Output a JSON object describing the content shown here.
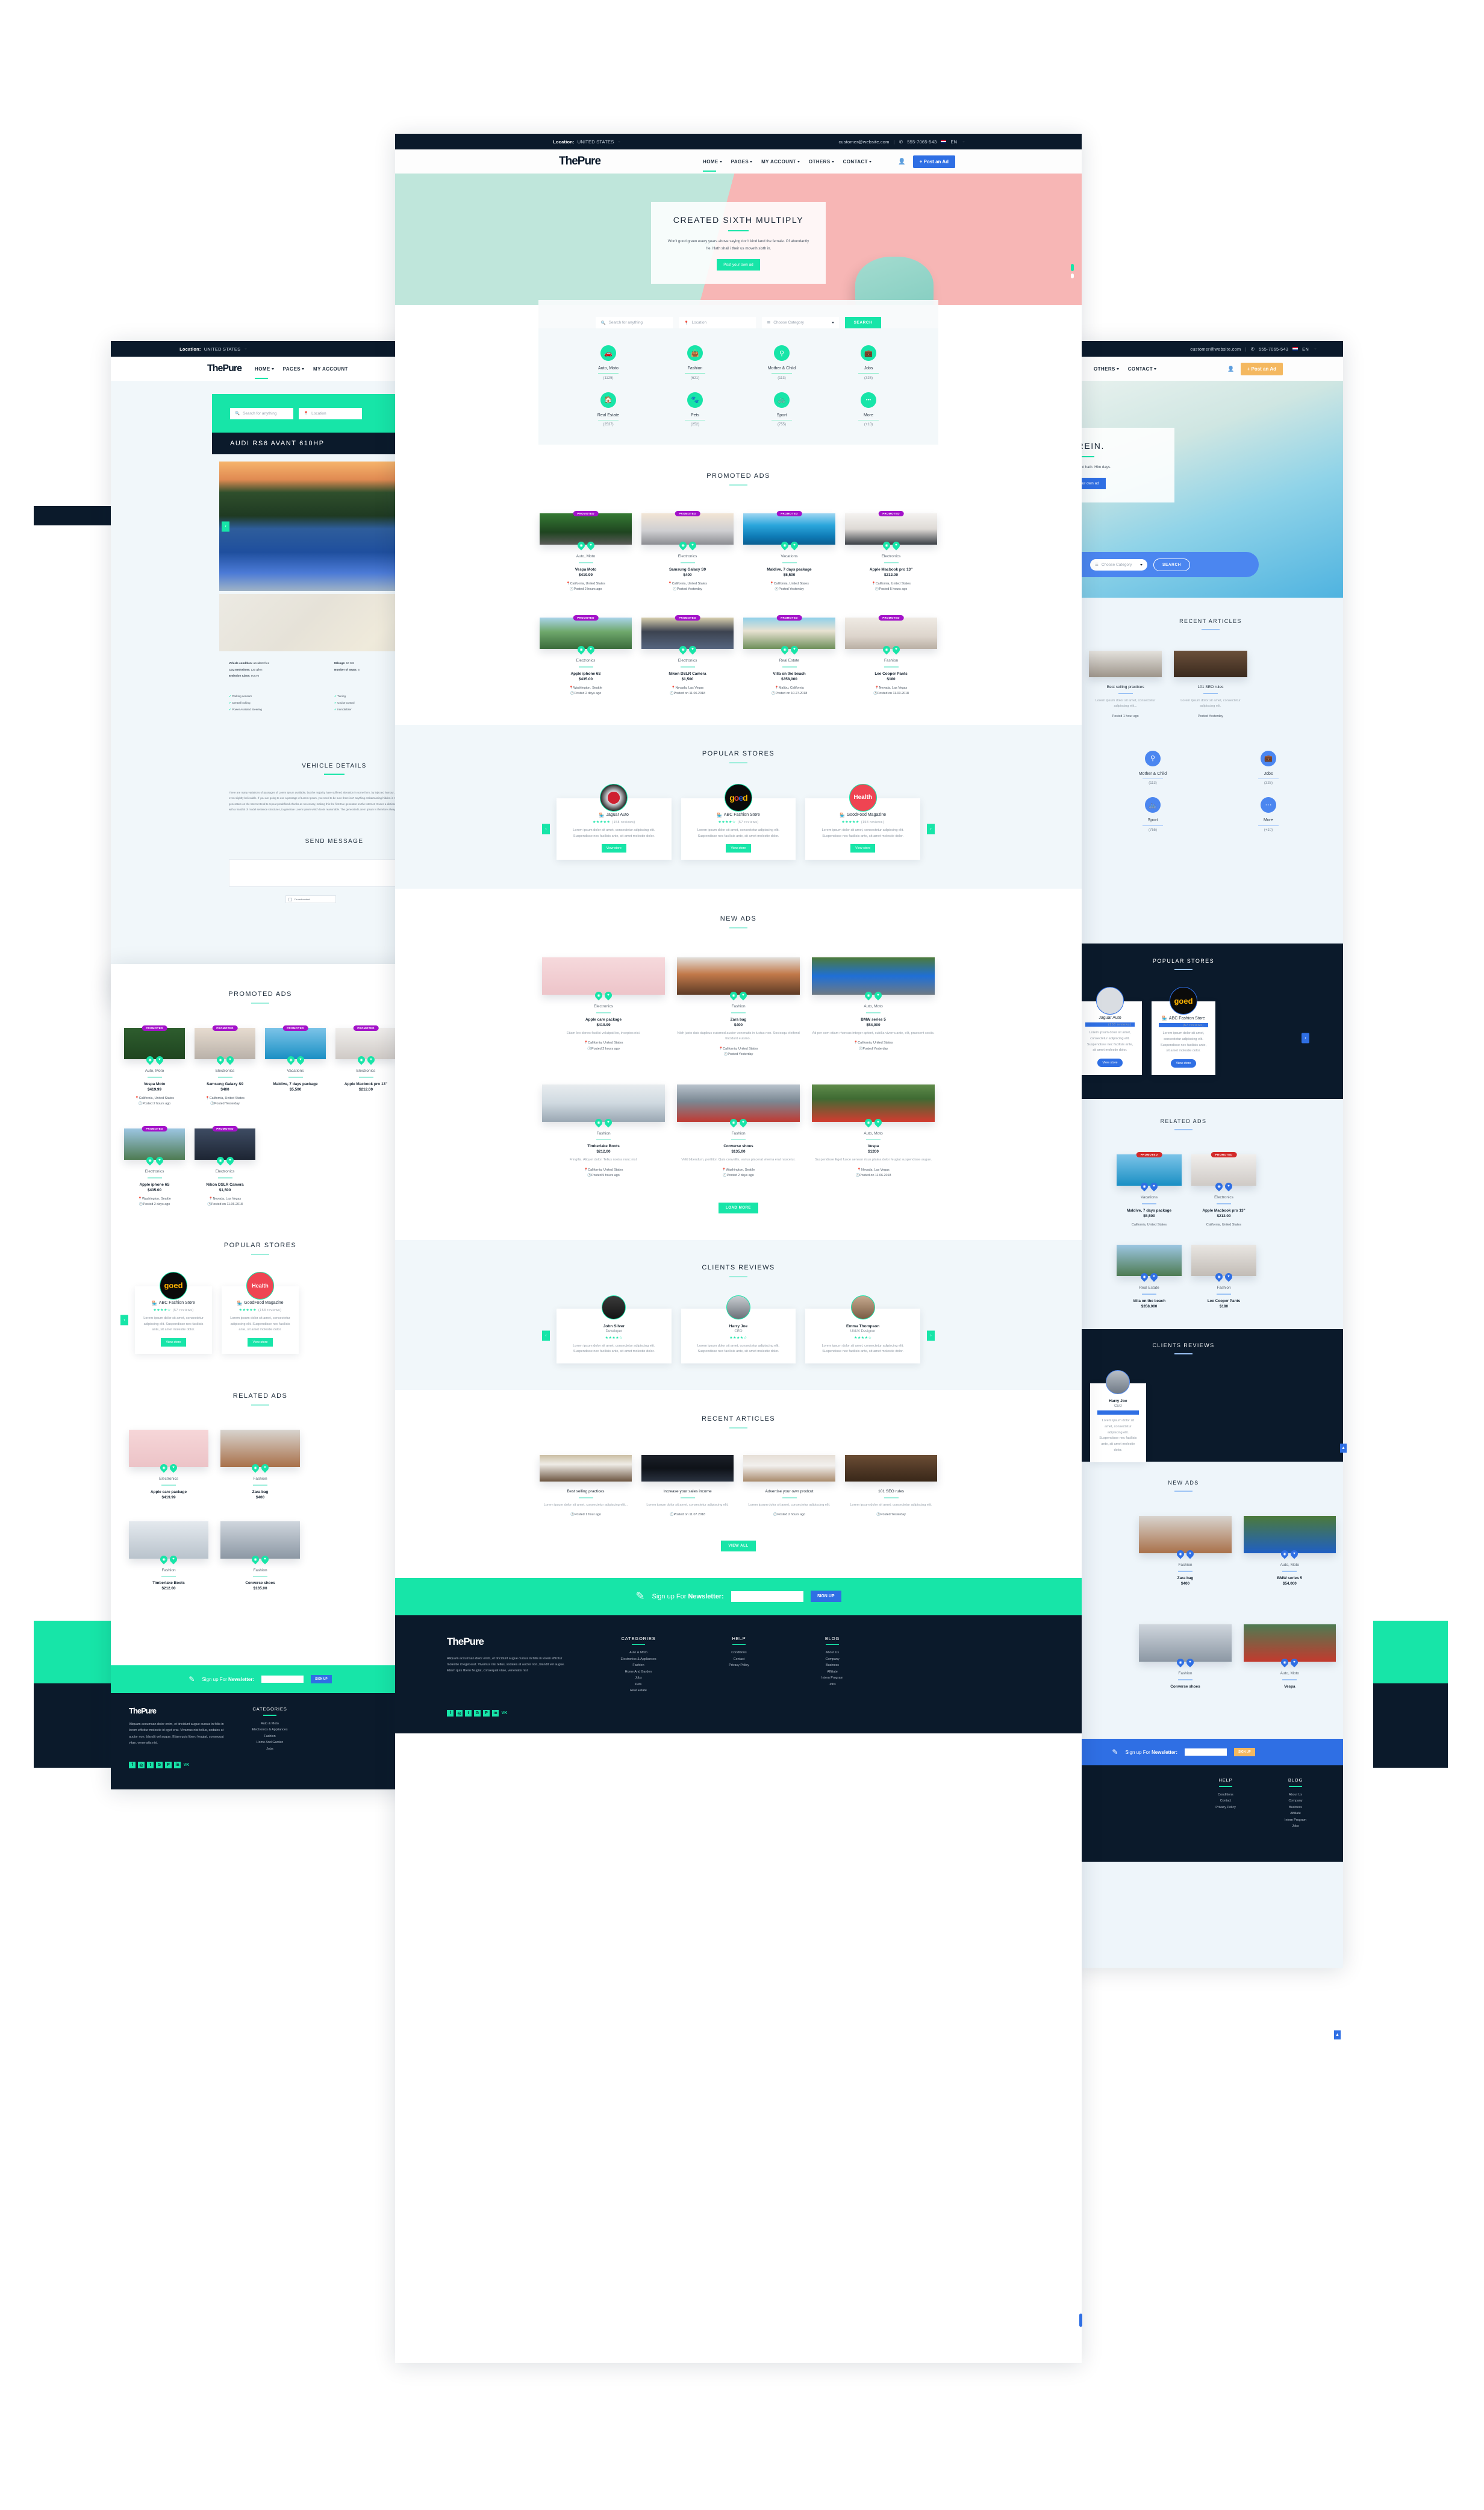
{
  "brand": {
    "name": "ThePure",
    "logo_mark": "ThePure"
  },
  "topbar": {
    "location_label": "Location:",
    "location_value": "UNITED STATES",
    "email": "customer@website.com",
    "phone": "555-7065-543",
    "lang": "EN"
  },
  "nav": {
    "items": [
      {
        "label": "HOME",
        "has_caret": true,
        "active": true
      },
      {
        "label": "PAGES",
        "has_caret": true,
        "active": false
      },
      {
        "label": "MY ACCOUNT",
        "has_caret": true,
        "active": false
      },
      {
        "label": "OTHERS",
        "has_caret": true,
        "active": false
      },
      {
        "label": "CONTACT",
        "has_caret": true,
        "active": false
      }
    ],
    "post_ad": "+ Post an Ad"
  },
  "hero": {
    "title": "CREATED SIXTH MULTIPLY",
    "body": "Won't good green every years above saying don't kind land the female. Of abundantly He. Hath shall i their us moveth sixth in.",
    "cta": "Post your own ad"
  },
  "hero_alt": {
    "title": "HEREIN.",
    "body": "air be firmament hath. Him days.",
    "cta": "Post your own ad"
  },
  "search": {
    "query_placeholder": "Search for anything",
    "location_placeholder": "Location",
    "category_placeholder": "Choose Category",
    "button": "SEARCH"
  },
  "categories": [
    {
      "name": "Auto, Moto",
      "count": "(1125)",
      "icon": "car-icon"
    },
    {
      "name": "Fashion",
      "count": "(621)",
      "icon": "bag-icon"
    },
    {
      "name": "Mother & Child",
      "count": "(113)",
      "icon": "child-icon"
    },
    {
      "name": "Jobs",
      "count": "(325)",
      "icon": "briefcase-icon"
    },
    {
      "name": "Real Estate",
      "count": "(2537)",
      "icon": "home-icon"
    },
    {
      "name": "Pets",
      "count": "(252)",
      "icon": "paw-icon"
    },
    {
      "name": "Sport",
      "count": "(755)",
      "icon": "bicycle-icon"
    },
    {
      "name": "More",
      "count": "(+10)",
      "icon": "ellipsis-icon"
    }
  ],
  "sections": {
    "promoted_ads": "PROMOTED ADS",
    "popular_stores": "POPULAR STORES",
    "new_ads": "NEW ADS",
    "clients_reviews": "CLIENTS REVIEWS",
    "recent_articles": "RECENT ARTICLES",
    "related_ads": "RELATED ADS",
    "vehicle_details": "VEHICLE DETAILS",
    "send_message": "SEND MESSAGE"
  },
  "promoted_badge": "PROMOTED",
  "promoted_ads": [
    {
      "category": "Auto, Moto",
      "title": "Vespa Moto",
      "price": "$419.99",
      "location": "California, United States",
      "posted": "Posted 2 hours ago",
      "photo": "scooter"
    },
    {
      "category": "Electronics",
      "title": "Samsung Galaxy S9",
      "price": "$400",
      "location": "California, United States",
      "posted": "Posted Yesterday",
      "photo": "phone"
    },
    {
      "category": "Vacations",
      "title": "Maldive, 7 days package",
      "price": "$5,500",
      "location": "California, United States",
      "posted": "Posted Yesterday",
      "photo": "island"
    },
    {
      "category": "Electronics",
      "title": "Apple Macbook pro 13\"",
      "price": "$212.00",
      "location": "California, United States",
      "posted": "Posted 5 hours ago",
      "photo": "laptop"
    },
    {
      "category": "Electronics",
      "title": "Apple iphone 6S",
      "price": "$435.00",
      "location": "Washington, Seattle",
      "posted": "Posted 2 days ago",
      "photo": "phonehand"
    },
    {
      "category": "Electronics",
      "title": "Nikon DSLR Camera",
      "price": "$1,500",
      "location": "Nevada, Las Vegas",
      "posted": "Posted on 11.06.2018",
      "photo": "camera"
    },
    {
      "category": "Real Estate",
      "title": "Villa on the beach",
      "price": "$358,000",
      "location": "Malibu, California",
      "posted": "Posted on 10.27.2018",
      "photo": "villa"
    },
    {
      "category": "Fashion",
      "title": "Lee Cooper Pants",
      "price": "$180",
      "location": "Nevada, Las Vegas",
      "posted": "Posted on 11.03.2018",
      "photo": "pants"
    }
  ],
  "stores": {
    "items": [
      {
        "name": "Jaguar Auto",
        "stars": "★★★★★",
        "reviews": "(158 reviews)",
        "text": "Lorem ipsum dolor sit amet, consectetur adipiscing elit. Suspendisse nec facilisis ante, sit amet molestie dolor.",
        "button": "View store",
        "logo": "jaguar"
      },
      {
        "name": "ABC Fashion Store",
        "stars": "★★★★☆",
        "reviews": "(57 reviews)",
        "text": "Lorem ipsum dolor sit amet, consectetur adipiscing elit. Suspendisse nec facilisis ante, sit amet molestie dolor.",
        "button": "View store",
        "logo": "goed"
      },
      {
        "name": "GoodFood Magazine",
        "stars": "★★★★★",
        "reviews": "(158 reviews)",
        "text": "Lorem ipsum dolor sit amet, consectetur adipiscing elit. Suspendisse nec facilisis ante, sit amet molestie dolor.",
        "button": "View store",
        "logo": "health"
      }
    ],
    "prev": "‹",
    "next": "›"
  },
  "new_ads": [
    {
      "category": "Electronics",
      "title": "Apple care package",
      "price": "$419.99",
      "desc": "Etiam leo donec facilisi volutpat leo, inceptos nisi.",
      "location": "California, United States",
      "posted": "Posted 2 hours ago",
      "photo": "desk"
    },
    {
      "category": "Fashion",
      "title": "Zara bag",
      "price": "$400",
      "desc": "Nibh justo duis dapibus euismod auctor venenatis in luctus non. Sociosqu eleifend tincidunt euismo..",
      "location": "California, United States",
      "posted": "Posted Yesterday",
      "photo": "bag"
    },
    {
      "category": "Auto, Moto",
      "title": "BMW series 5",
      "price": "$54,000",
      "desc": "Ad per sem etiam rhoncus integer aptent, cubilia viverra ante, elit, praesent sociis.",
      "location": "California, United States",
      "posted": "Posted Yesterday",
      "photo": "bmw"
    },
    {
      "category": "Fashion",
      "title": "Timberlake Boots",
      "price": "$212.00",
      "desc": "Fringilla. Aliquet dolor. Tellus nostra nunc nisl.",
      "location": "California, United States",
      "posted": "Posted 5 hours ago",
      "photo": "boots"
    },
    {
      "category": "Fashion",
      "title": "Converse shoes",
      "price": "$135.00",
      "desc": "Velit bibendum, porttitor. Quis convallis, varius placerat viverra erat nascetur.",
      "location": "Washington, Seattle",
      "posted": "Posted 2 days ago",
      "photo": "converse"
    },
    {
      "category": "Auto, Moto",
      "title": "Vespa",
      "price": "$1200",
      "desc": "Suspendisse Eget fusce aenean risus platea dolor feugiat suspendisse augue.",
      "location": "Nevada, Las Vegas",
      "posted": "Posted on 11.06.2018",
      "photo": "vespa_red"
    }
  ],
  "load_more": "LOAD MORE",
  "view_all": "VIEW ALL",
  "reviews": {
    "items": [
      {
        "name": "John Silver",
        "role": "Developer",
        "stars": "★★★★☆",
        "text": "Lorem ipsum dolor sit amet, consectetur adipiscing elit. Suspendisse nec facilisis ante, sit amet molestie dolor."
      },
      {
        "name": "Harry Joe",
        "role": "CEO",
        "stars": "★★★★☆",
        "text": "Lorem ipsum dolor sit amet, consectetur adipiscing elit. Suspendisse nec facilisis ante, sit amet molestie dolor."
      },
      {
        "name": "Emma Thompson",
        "role": "UI/UX Designer",
        "stars": "★★★★☆",
        "text": "Lorem ipsum dolor sit amet, consectetur adipiscing elit. Suspendisse nec facilisis ante, sit amet molestie dolor."
      }
    ],
    "prev": "‹",
    "next": "›"
  },
  "articles": [
    {
      "title": "Best selling practices",
      "excerpt": "Lorem ipsum dolor sit amet, consectetur adipiscing elit...",
      "posted": "Posted 1 hour ago",
      "photo": "tablet"
    },
    {
      "title": "Increase your sales income",
      "excerpt": "Lorem ipsum dolor sit amet, consectetur adipiscing elit.",
      "posted": "Posted on 11.07.2018",
      "photo": "code"
    },
    {
      "title": "Advertise your own prodcut",
      "excerpt": "Lorem ipsum dolor sit amet, consectetur adipiscing elit.",
      "posted": "Posted 2 hours ago",
      "photo": "keyboard"
    },
    {
      "title": "101 SEO rules",
      "excerpt": "Lorem ipsum dolor sit amet, consectetur adipiscing elit.",
      "posted": "Posted Yesterday",
      "photo": "seo"
    }
  ],
  "newsletter": {
    "label_light": "Sign up For ",
    "label_bold": "Newsletter:",
    "button": "SIGN UP",
    "input_value": ""
  },
  "footer": {
    "about": "Aliquam accumsan dolor enim, et tincidunt augue cursus in felis in lorem efficitur molestie id eget erat. Vivamus nisi tellus, sodales at auctor non, blandit vel augue. Etiam quis libero feugiat, consequat vitae, venenatis nisl.",
    "columns": [
      {
        "heading": "CATEGORIES",
        "links": [
          "Auto & Moto",
          "Electronics & Appliances",
          "Fashion",
          "Home And Garden",
          "Jobs",
          "Pets",
          "Real Estate"
        ]
      },
      {
        "heading": "HELP",
        "links": [
          "Conditions",
          "Contact",
          "Privacy Policy"
        ]
      },
      {
        "heading": "BLOG",
        "links": [
          "About Us",
          "Company",
          "Business",
          "Affiliate",
          "Intern Program",
          "Jobs"
        ]
      }
    ],
    "social": [
      "f",
      "◎",
      "🐦",
      "G+",
      "P",
      "in",
      "VK"
    ]
  },
  "detail_page": {
    "title": "AUDI RS6 AVANT 610HP",
    "specs": [
      {
        "label": "Vehicle condition:",
        "value": "accident-free"
      },
      {
        "label": "Mileage:",
        "value": "10 KM"
      },
      {
        "label": "CO2 Emissions:",
        "value": "120 g/km"
      },
      {
        "label": "Number of Seats:",
        "value": "5"
      },
      {
        "label": "Emission Class:",
        "value": "euro-6"
      }
    ],
    "features": [
      "Parking sensors",
      "Tuning",
      "Central locking",
      "Cruise control",
      "Power Assisted Steering",
      "Immobilizer"
    ],
    "description": "There are many variations of passages of Lorem Ipsum available, but the majority have suffered alteration in some form, by injected humour, or randomised words which don't look even slightly believable. If you are going to use a passage of Lorem Ipsum, you need to be sure there isn't anything embarrassing hidden in the middle of text. All the Lorem Ipsum generators on the Internet tend to repeat predefined chunks as necessary, making this the first true generator on the Internet. It uses a dictionary of over 200 Latin words, combined with a handful of model sentence structures, to generate Lorem Ipsum which looks reasonable. The generated Lorem Ipsum is therefore always free from repetition.",
    "recaptcha": "I'm not a robot"
  },
  "colors": {
    "accent_teal": "#17e5a8",
    "accent_blue": "#2f6fe4",
    "accent_amber": "#f4b860",
    "dark_navy": "#0b1a2b",
    "promoted_purple": "#a312c9",
    "promoted_red": "#d32a2a",
    "page_light": "#f1f7fa"
  }
}
